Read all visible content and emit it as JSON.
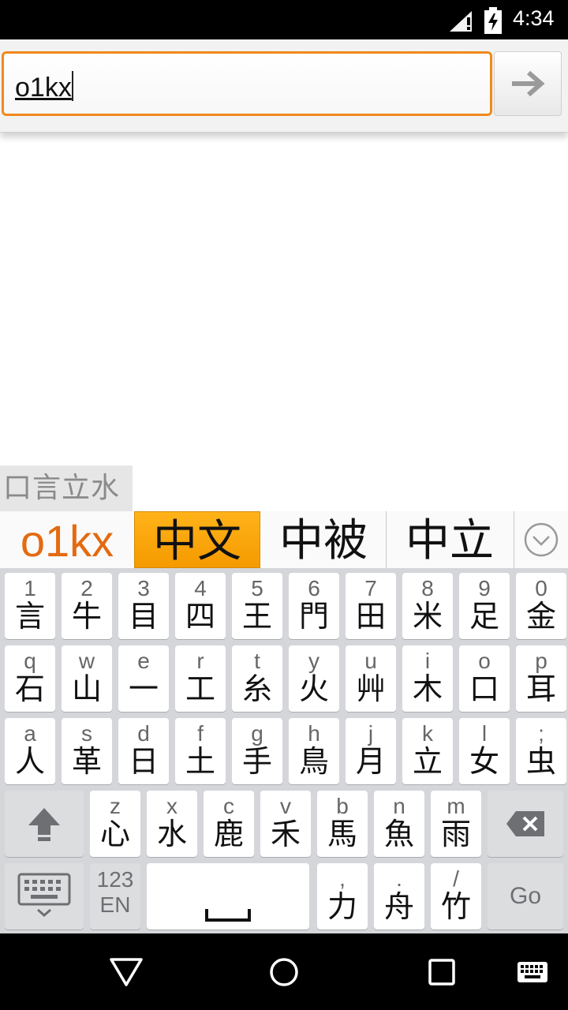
{
  "status_bar": {
    "time": "4:34"
  },
  "url_bar": {
    "value": "o1kx"
  },
  "ime": {
    "radicals": "口言立水",
    "composing": "o1kx",
    "candidates": [
      "中文",
      "中被",
      "中立"
    ],
    "selected_index": 0
  },
  "keyboard": {
    "row1": [
      {
        "sub": "1",
        "main": "言"
      },
      {
        "sub": "2",
        "main": "牛"
      },
      {
        "sub": "3",
        "main": "目"
      },
      {
        "sub": "4",
        "main": "四"
      },
      {
        "sub": "5",
        "main": "王"
      },
      {
        "sub": "6",
        "main": "門"
      },
      {
        "sub": "7",
        "main": "田"
      },
      {
        "sub": "8",
        "main": "米"
      },
      {
        "sub": "9",
        "main": "足"
      },
      {
        "sub": "0",
        "main": "金"
      }
    ],
    "row2": [
      {
        "sub": "q",
        "main": "石"
      },
      {
        "sub": "w",
        "main": "山"
      },
      {
        "sub": "e",
        "main": "一"
      },
      {
        "sub": "r",
        "main": "工"
      },
      {
        "sub": "t",
        "main": "糸"
      },
      {
        "sub": "y",
        "main": "火"
      },
      {
        "sub": "u",
        "main": "艸"
      },
      {
        "sub": "i",
        "main": "木"
      },
      {
        "sub": "o",
        "main": "口"
      },
      {
        "sub": "p",
        "main": "耳"
      }
    ],
    "row3": [
      {
        "sub": "a",
        "main": "人"
      },
      {
        "sub": "s",
        "main": "革"
      },
      {
        "sub": "d",
        "main": "日"
      },
      {
        "sub": "f",
        "main": "土"
      },
      {
        "sub": "g",
        "main": "手"
      },
      {
        "sub": "h",
        "main": "鳥"
      },
      {
        "sub": "j",
        "main": "月"
      },
      {
        "sub": "k",
        "main": "立"
      },
      {
        "sub": "l",
        "main": "女"
      },
      {
        "sub": ";",
        "main": "虫"
      }
    ],
    "row4": [
      {
        "sub": "z",
        "main": "心"
      },
      {
        "sub": "x",
        "main": "水"
      },
      {
        "sub": "c",
        "main": "鹿"
      },
      {
        "sub": "v",
        "main": "禾"
      },
      {
        "sub": "b",
        "main": "馬"
      },
      {
        "sub": "n",
        "main": "魚"
      },
      {
        "sub": "m",
        "main": "雨"
      }
    ],
    "row5_punct": [
      {
        "sub": ",",
        "main": "力"
      },
      {
        "sub": ".",
        "main": "舟"
      },
      {
        "sub": "/",
        "main": "竹"
      }
    ],
    "symbols_key_top": "123",
    "symbols_key_bottom": "EN",
    "go_label": "Go"
  },
  "colors": {
    "accent": "#f08a1d",
    "candidate_selected": "#f7a600",
    "composing_text": "#e46a10"
  }
}
